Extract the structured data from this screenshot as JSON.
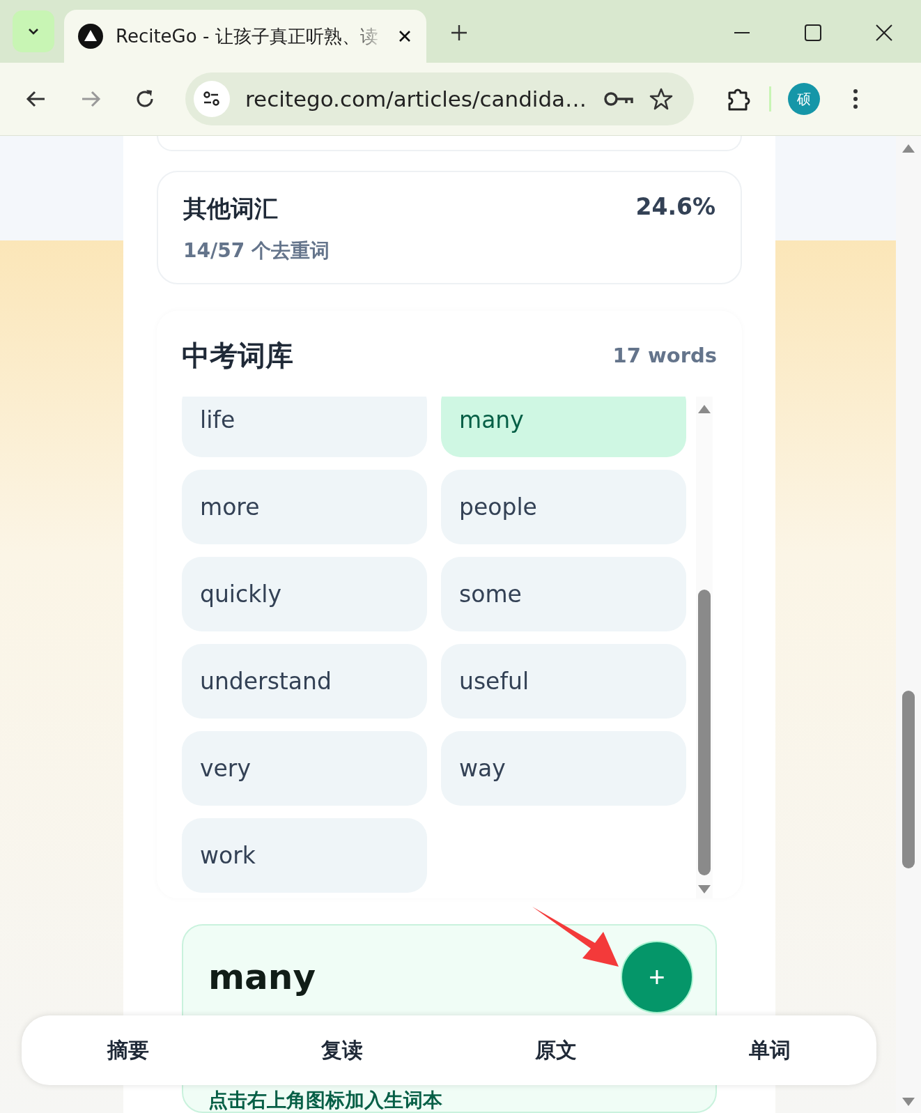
{
  "browser": {
    "tab": {
      "title": "ReciteGo - 让孩子真正听熟、读"
    },
    "address": "recitego.com/articles/candida…",
    "avatar": "硕"
  },
  "stats_card": {
    "title": "其他词汇",
    "subtitle": "14/57 个去重词",
    "percent": "24.6%"
  },
  "word_bank": {
    "title": "中考词库",
    "count": "17 words",
    "words": [
      {
        "text": "life",
        "selected": false
      },
      {
        "text": "many",
        "selected": true
      },
      {
        "text": "more",
        "selected": false
      },
      {
        "text": "people",
        "selected": false
      },
      {
        "text": "quickly",
        "selected": false
      },
      {
        "text": "some",
        "selected": false
      },
      {
        "text": "understand",
        "selected": false
      },
      {
        "text": "useful",
        "selected": false
      },
      {
        "text": "very",
        "selected": false
      },
      {
        "text": "way",
        "selected": false
      },
      {
        "text": "work",
        "selected": false
      }
    ]
  },
  "detail": {
    "word": "many",
    "button": "+",
    "hint": "点击右上角图标加入生词本"
  },
  "bottom_nav": [
    {
      "label": "摘要",
      "selected": false
    },
    {
      "label": "复读",
      "selected": false
    },
    {
      "label": "原文",
      "selected": false
    },
    {
      "label": "单词",
      "selected": false
    }
  ]
}
